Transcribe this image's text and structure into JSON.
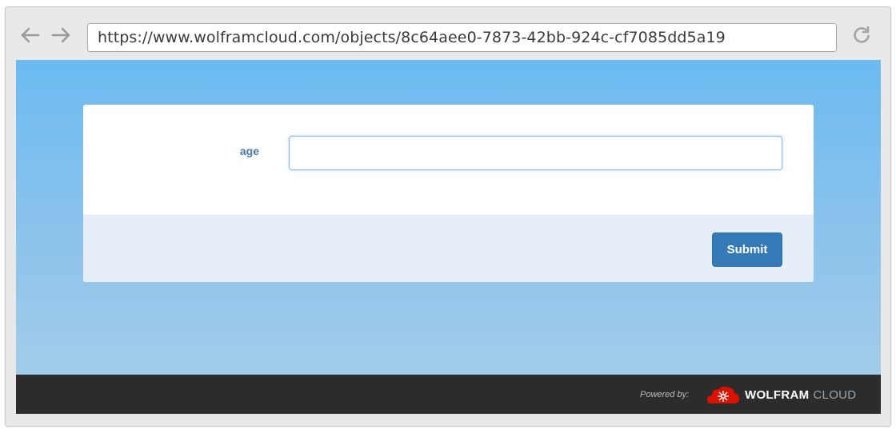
{
  "browser": {
    "url": "https://www.wolframcloud.com/objects/8c64aee0-7873-42bb-924c-cf7085dd5a19",
    "back_icon": "arrow-left-icon",
    "forward_icon": "arrow-right-icon",
    "reload_icon": "reload-icon"
  },
  "form": {
    "fields": [
      {
        "label": "age",
        "value": "",
        "placeholder": ""
      }
    ],
    "submit_label": "Submit"
  },
  "footer": {
    "powered_by": "Powered by:",
    "brand_name": "WOLFRAM",
    "brand_suffix": "CLOUD",
    "logo_icon": "wolfram-spikey-icon"
  },
  "colors": {
    "accent": "#337ab7",
    "background_top": "#6bbaf2",
    "background_bottom": "#a9cde8",
    "footer_background": "#2c2c2c",
    "brand_red": "#dd1100"
  }
}
